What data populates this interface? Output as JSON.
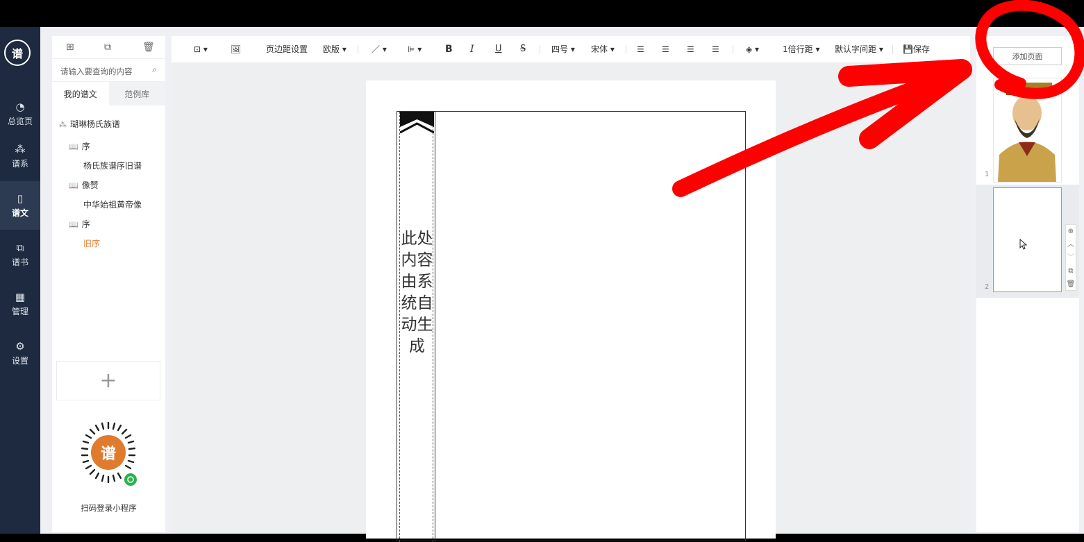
{
  "nav": {
    "logo": "谱",
    "items": [
      {
        "label": "总览页",
        "icon": "pie-chart-icon",
        "glyph": "◔"
      },
      {
        "label": "谱系",
        "icon": "tree-icon",
        "glyph": "⁂"
      },
      {
        "label": "谱文",
        "icon": "document-icon",
        "glyph": "▯",
        "active": true
      },
      {
        "label": "谱书",
        "icon": "book-icon",
        "glyph": "⧉"
      },
      {
        "label": "管理",
        "icon": "grid-icon",
        "glyph": "▦"
      },
      {
        "label": "设置",
        "icon": "gear-icon",
        "glyph": "⚙"
      }
    ]
  },
  "tree": {
    "search_placeholder": "请输入要查询的内容",
    "tabs": [
      "我的谱文",
      "范例库"
    ],
    "root": "瑚琳杨氏族谱",
    "nodes": [
      {
        "label": "序",
        "type": "folder"
      },
      {
        "label": "杨氏族谱序旧谱",
        "type": "leaf"
      },
      {
        "label": "像赞",
        "type": "folder"
      },
      {
        "label": "中华始祖黄帝像",
        "type": "leaf"
      },
      {
        "label": "序",
        "type": "folder"
      },
      {
        "label": "旧序",
        "type": "leaf",
        "active": true
      }
    ],
    "add_symbol": "+",
    "qr_caption": "扫码登录小程序"
  },
  "toolbar": {
    "margin_settings": "页边距设置",
    "layout": "欧版",
    "bold": "B",
    "italic": "I",
    "underline": "U",
    "strike": "S",
    "font_size": "四号",
    "font_family": "宋体",
    "line_spacing": "1倍行距",
    "letter_spacing": "默认字间距",
    "save": "保存"
  },
  "page": {
    "vertical_text": "此处内容由系统自动生成"
  },
  "pages_panel": {
    "add_page": "添加页面",
    "thumbs": [
      {
        "number": "1"
      },
      {
        "number": "2"
      }
    ]
  },
  "colors": {
    "nav_bg": "#1d2a3f",
    "accent_orange": "#e07b2e",
    "annotation_red": "#ff0000"
  }
}
